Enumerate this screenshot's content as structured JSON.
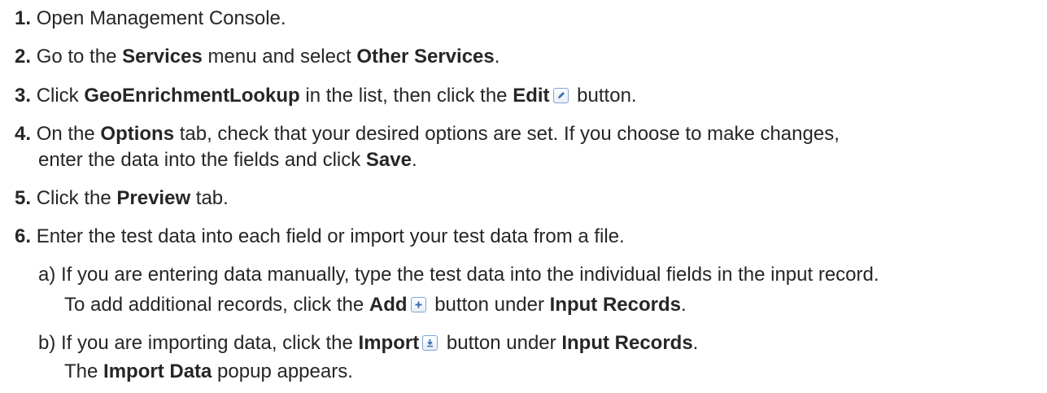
{
  "steps": [
    {
      "num": "1.",
      "text": "Open Management Console."
    },
    {
      "num": "2.",
      "pre": "Go to the ",
      "b1": "Services",
      "mid": " menu and select ",
      "b2": "Other Services",
      "post": "."
    },
    {
      "num": "3.",
      "pre": "Click ",
      "b1": "GeoEnrichmentLookup",
      "mid": " in the list, then click the ",
      "b2": "Edit",
      "post": " button.",
      "icon": "pencil-edit-icon"
    },
    {
      "num": "4.",
      "line1": "On the ",
      "b1": "Options",
      "line1b": " tab, check that your desired options are set. If you choose to make changes,",
      "line2": "enter the data into the fields and click ",
      "b2": "Save",
      "post": "."
    },
    {
      "num": "5.",
      "pre": "Click the ",
      "b1": "Preview",
      "post": " tab."
    },
    {
      "num": "6.",
      "text": "Enter the test data into each field or import your test data from a file."
    }
  ],
  "substeps": [
    {
      "label": "a)",
      "line1": "If you are entering data manually, type the test data into the individual fields in the input record.",
      "line2pre": "To add additional records, click the ",
      "b1": "Add",
      "line2mid": " button under ",
      "b2": "Input Records",
      "post": ".",
      "icon": "plus-add-icon"
    },
    {
      "label": "b)",
      "pre": "If you are importing data, click the ",
      "b1": "Import",
      "mid": " button under ",
      "b2": "Input Records",
      "post": ".",
      "icon": "import-download-icon",
      "line2pre": "The ",
      "line2b": "Import Data",
      "line2post": " popup appears."
    }
  ]
}
